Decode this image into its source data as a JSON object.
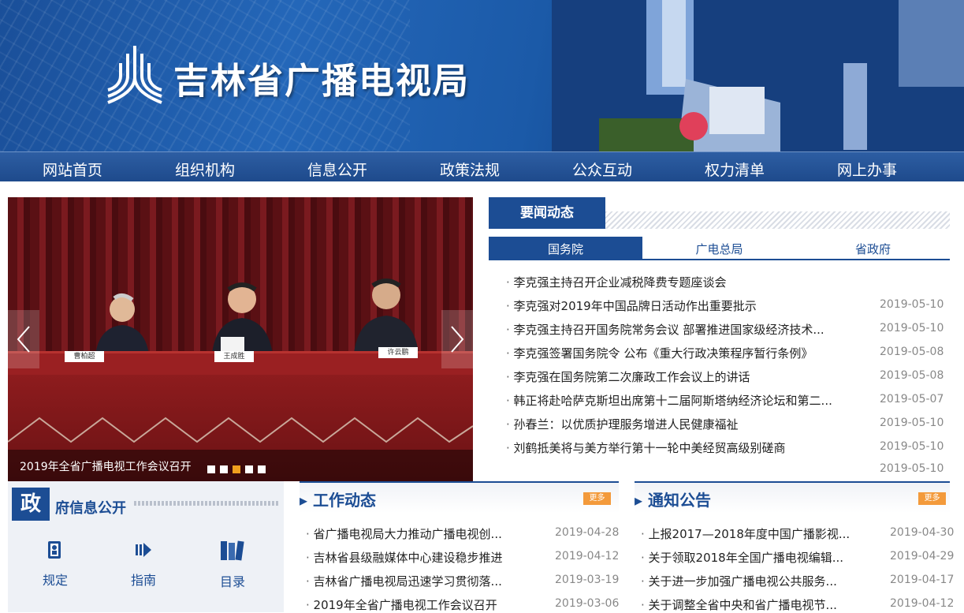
{
  "site": {
    "title": "吉林省广播电视局"
  },
  "nav": [
    "网站首页",
    "组织机构",
    "信息公开",
    "政策法规",
    "公众互动",
    "权力清单",
    "网上办事"
  ],
  "slider": {
    "caption": "2019年全省广播电视工作会议召开",
    "dots": 5,
    "active_dot": 3,
    "nameplates": [
      "曹柏超",
      "王成胜",
      "许云鹏"
    ]
  },
  "news": {
    "title": "要闻动态",
    "tabs": [
      "国务院",
      "广电总局",
      "省政府"
    ],
    "active_tab": 0,
    "items": [
      {
        "title": "李克强主持召开企业减税降费专题座谈会",
        "date": ""
      },
      {
        "title": "李克强对2019年中国品牌日活动作出重要批示",
        "date": "2019-05-10"
      },
      {
        "title": "李克强主持召开国务院常务会议 部署推进国家级经济技术...",
        "date": "2019-05-10"
      },
      {
        "title": "李克强签署国务院令 公布《重大行政决策程序暂行条例》",
        "date": "2019-05-08"
      },
      {
        "title": "李克强在国务院第二次廉政工作会议上的讲话",
        "date": "2019-05-08"
      },
      {
        "title": "韩正将赴哈萨克斯坦出席第十二届阿斯塔纳经济论坛和第二...",
        "date": "2019-05-07"
      },
      {
        "title": "孙春兰：以优质护理服务增进人民健康福祉",
        "date": "2019-05-10"
      },
      {
        "title": "刘鹤抵美将与美方举行第十一轮中美经贸高级别磋商",
        "date": "2019-05-10"
      }
    ],
    "trailing_date": "2019-05-10"
  },
  "gov": {
    "zheng": "政",
    "rest": "府信息公开",
    "items": [
      {
        "label": "规定",
        "icon": "book-person-icon"
      },
      {
        "label": "指南",
        "icon": "guide-arrow-icon"
      },
      {
        "label": "目录",
        "icon": "books-icon"
      }
    ]
  },
  "work": {
    "title": "工作动态",
    "more": "更多",
    "items": [
      {
        "title": "省广播电视局大力推动广播电视创...",
        "date": "2019-04-28"
      },
      {
        "title": "吉林省县级融媒体中心建设稳步推进",
        "date": "2019-04-12"
      },
      {
        "title": "吉林省广播电视局迅速学习贯彻落...",
        "date": "2019-03-19"
      },
      {
        "title": "2019年全省广播电视工作会议召开",
        "date": "2019-03-06"
      }
    ]
  },
  "notice": {
    "title": "通知公告",
    "more": "更多",
    "items": [
      {
        "title": "上报2017—2018年度中国广播影视...",
        "date": "2019-04-30"
      },
      {
        "title": "关于领取2018年全国广播电视编辑...",
        "date": "2019-04-29"
      },
      {
        "title": "关于进一步加强广播电视公共服务...",
        "date": "2019-04-17"
      },
      {
        "title": "关于调整全省中央和省广播电视节...",
        "date": "2019-04-12"
      }
    ]
  },
  "colors": {
    "brand": "#1c4d94",
    "accent": "#f0a01e",
    "more": "#f39a3b"
  }
}
